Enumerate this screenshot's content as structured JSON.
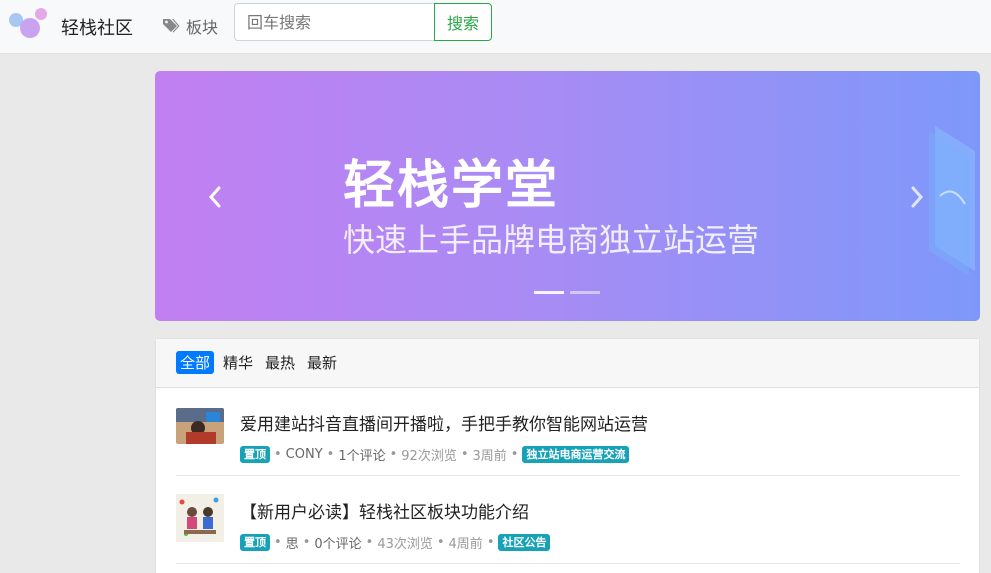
{
  "header": {
    "brand": "轻栈社区",
    "board_label": "板块",
    "search_placeholder": "回车搜索",
    "search_button": "搜索"
  },
  "banner": {
    "title": "轻栈学堂",
    "subtitle": "快速上手品牌电商独立站运营",
    "slide_count": 2,
    "active_slide": 1
  },
  "tabs": [
    {
      "label": "全部",
      "active": true
    },
    {
      "label": "精华",
      "active": false
    },
    {
      "label": "最热",
      "active": false
    },
    {
      "label": "最新",
      "active": false
    }
  ],
  "posts": [
    {
      "title": "爱用建站抖音直播间开播啦，手把手教你智能网站运营",
      "pin_label": "置顶",
      "author": "CONY",
      "comments": "1个评论",
      "views": "92次浏览",
      "time": "3周前",
      "board": "独立站电商运营交流"
    },
    {
      "title": "【新用户必读】轻栈社区板块功能介绍",
      "pin_label": "置顶",
      "author": "思",
      "comments": "0个评论",
      "views": "43次浏览",
      "time": "4周前",
      "board": "社区公告"
    }
  ],
  "colors": {
    "primary": "#007bff",
    "success": "#28a745",
    "badge": "#17a2b8",
    "banner_start": "#c27ff2",
    "banner_end": "#7e98fa"
  }
}
